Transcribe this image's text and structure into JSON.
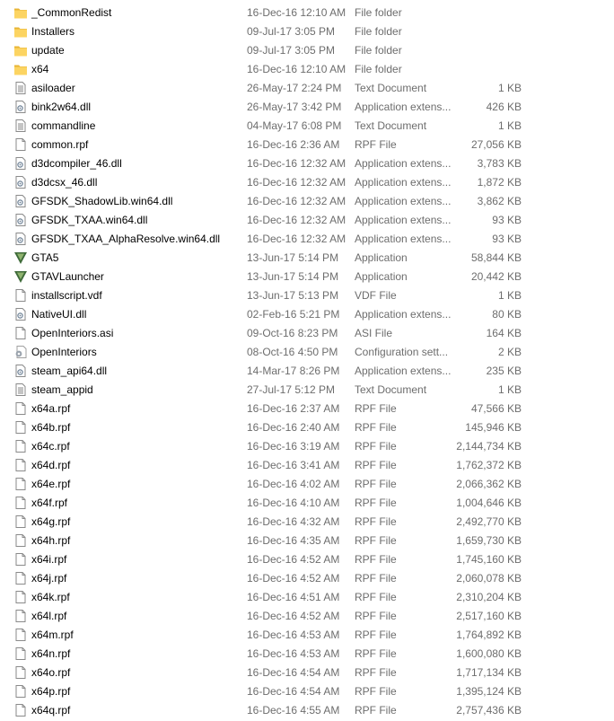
{
  "files": [
    {
      "name": "_CommonRedist",
      "date": "16-Dec-16 12:10 AM",
      "type": "File folder",
      "size": "",
      "icon": "folder-icon"
    },
    {
      "name": "Installers",
      "date": "09-Jul-17 3:05 PM",
      "type": "File folder",
      "size": "",
      "icon": "folder-icon"
    },
    {
      "name": "update",
      "date": "09-Jul-17 3:05 PM",
      "type": "File folder",
      "size": "",
      "icon": "folder-icon"
    },
    {
      "name": "x64",
      "date": "16-Dec-16 12:10 AM",
      "type": "File folder",
      "size": "",
      "icon": "folder-icon"
    },
    {
      "name": "asiloader",
      "date": "26-May-17 2:24 PM",
      "type": "Text Document",
      "size": "1 KB",
      "icon": "text-file-icon"
    },
    {
      "name": "bink2w64.dll",
      "date": "26-May-17 3:42 PM",
      "type": "Application extens...",
      "size": "426 KB",
      "icon": "dll-file-icon"
    },
    {
      "name": "commandline",
      "date": "04-May-17 6:08 PM",
      "type": "Text Document",
      "size": "1 KB",
      "icon": "text-file-icon"
    },
    {
      "name": "common.rpf",
      "date": "16-Dec-16 2:36 AM",
      "type": "RPF File",
      "size": "27,056 KB",
      "icon": "blank-file-icon"
    },
    {
      "name": "d3dcompiler_46.dll",
      "date": "16-Dec-16 12:32 AM",
      "type": "Application extens...",
      "size": "3,783 KB",
      "icon": "dll-file-icon"
    },
    {
      "name": "d3dcsx_46.dll",
      "date": "16-Dec-16 12:32 AM",
      "type": "Application extens...",
      "size": "1,872 KB",
      "icon": "dll-file-icon"
    },
    {
      "name": "GFSDK_ShadowLib.win64.dll",
      "date": "16-Dec-16 12:32 AM",
      "type": "Application extens...",
      "size": "3,862 KB",
      "icon": "dll-file-icon"
    },
    {
      "name": "GFSDK_TXAA.win64.dll",
      "date": "16-Dec-16 12:32 AM",
      "type": "Application extens...",
      "size": "93 KB",
      "icon": "dll-file-icon"
    },
    {
      "name": "GFSDK_TXAA_AlphaResolve.win64.dll",
      "date": "16-Dec-16 12:32 AM",
      "type": "Application extens...",
      "size": "93 KB",
      "icon": "dll-file-icon"
    },
    {
      "name": "GTA5",
      "date": "13-Jun-17 5:14 PM",
      "type": "Application",
      "size": "58,844 KB",
      "icon": "gta-v-app-icon"
    },
    {
      "name": "GTAVLauncher",
      "date": "13-Jun-17 5:14 PM",
      "type": "Application",
      "size": "20,442 KB",
      "icon": "gta-v-app-icon"
    },
    {
      "name": "installscript.vdf",
      "date": "13-Jun-17 5:13 PM",
      "type": "VDF File",
      "size": "1 KB",
      "icon": "blank-file-icon"
    },
    {
      "name": "NativeUI.dll",
      "date": "02-Feb-16 5:21 PM",
      "type": "Application extens...",
      "size": "80 KB",
      "icon": "dll-file-icon"
    },
    {
      "name": "OpenInteriors.asi",
      "date": "09-Oct-16 8:23 PM",
      "type": "ASI File",
      "size": "164 KB",
      "icon": "blank-file-icon"
    },
    {
      "name": "OpenInteriors",
      "date": "08-Oct-16 4:50 PM",
      "type": "Configuration sett...",
      "size": "2 KB",
      "icon": "settings-file-icon"
    },
    {
      "name": "steam_api64.dll",
      "date": "14-Mar-17 8:26 PM",
      "type": "Application extens...",
      "size": "235 KB",
      "icon": "dll-file-icon"
    },
    {
      "name": "steam_appid",
      "date": "27-Jul-17 5:12 PM",
      "type": "Text Document",
      "size": "1 KB",
      "icon": "text-file-icon"
    },
    {
      "name": "x64a.rpf",
      "date": "16-Dec-16 2:37 AM",
      "type": "RPF File",
      "size": "47,566 KB",
      "icon": "blank-file-icon"
    },
    {
      "name": "x64b.rpf",
      "date": "16-Dec-16 2:40 AM",
      "type": "RPF File",
      "size": "145,946 KB",
      "icon": "blank-file-icon"
    },
    {
      "name": "x64c.rpf",
      "date": "16-Dec-16 3:19 AM",
      "type": "RPF File",
      "size": "2,144,734 KB",
      "icon": "blank-file-icon"
    },
    {
      "name": "x64d.rpf",
      "date": "16-Dec-16 3:41 AM",
      "type": "RPF File",
      "size": "1,762,372 KB",
      "icon": "blank-file-icon"
    },
    {
      "name": "x64e.rpf",
      "date": "16-Dec-16 4:02 AM",
      "type": "RPF File",
      "size": "2,066,362 KB",
      "icon": "blank-file-icon"
    },
    {
      "name": "x64f.rpf",
      "date": "16-Dec-16 4:10 AM",
      "type": "RPF File",
      "size": "1,004,646 KB",
      "icon": "blank-file-icon"
    },
    {
      "name": "x64g.rpf",
      "date": "16-Dec-16 4:32 AM",
      "type": "RPF File",
      "size": "2,492,770 KB",
      "icon": "blank-file-icon"
    },
    {
      "name": "x64h.rpf",
      "date": "16-Dec-16 4:35 AM",
      "type": "RPF File",
      "size": "1,659,730 KB",
      "icon": "blank-file-icon"
    },
    {
      "name": "x64i.rpf",
      "date": "16-Dec-16 4:52 AM",
      "type": "RPF File",
      "size": "1,745,160 KB",
      "icon": "blank-file-icon"
    },
    {
      "name": "x64j.rpf",
      "date": "16-Dec-16 4:52 AM",
      "type": "RPF File",
      "size": "2,060,078 KB",
      "icon": "blank-file-icon"
    },
    {
      "name": "x64k.rpf",
      "date": "16-Dec-16 4:51 AM",
      "type": "RPF File",
      "size": "2,310,204 KB",
      "icon": "blank-file-icon"
    },
    {
      "name": "x64l.rpf",
      "date": "16-Dec-16 4:52 AM",
      "type": "RPF File",
      "size": "2,517,160 KB",
      "icon": "blank-file-icon"
    },
    {
      "name": "x64m.rpf",
      "date": "16-Dec-16 4:53 AM",
      "type": "RPF File",
      "size": "1,764,892 KB",
      "icon": "blank-file-icon"
    },
    {
      "name": "x64n.rpf",
      "date": "16-Dec-16 4:53 AM",
      "type": "RPF File",
      "size": "1,600,080 KB",
      "icon": "blank-file-icon"
    },
    {
      "name": "x64o.rpf",
      "date": "16-Dec-16 4:54 AM",
      "type": "RPF File",
      "size": "1,717,134 KB",
      "icon": "blank-file-icon"
    },
    {
      "name": "x64p.rpf",
      "date": "16-Dec-16 4:54 AM",
      "type": "RPF File",
      "size": "1,395,124 KB",
      "icon": "blank-file-icon"
    },
    {
      "name": "x64q.rpf",
      "date": "16-Dec-16 4:55 AM",
      "type": "RPF File",
      "size": "2,757,436 KB",
      "icon": "blank-file-icon"
    }
  ]
}
